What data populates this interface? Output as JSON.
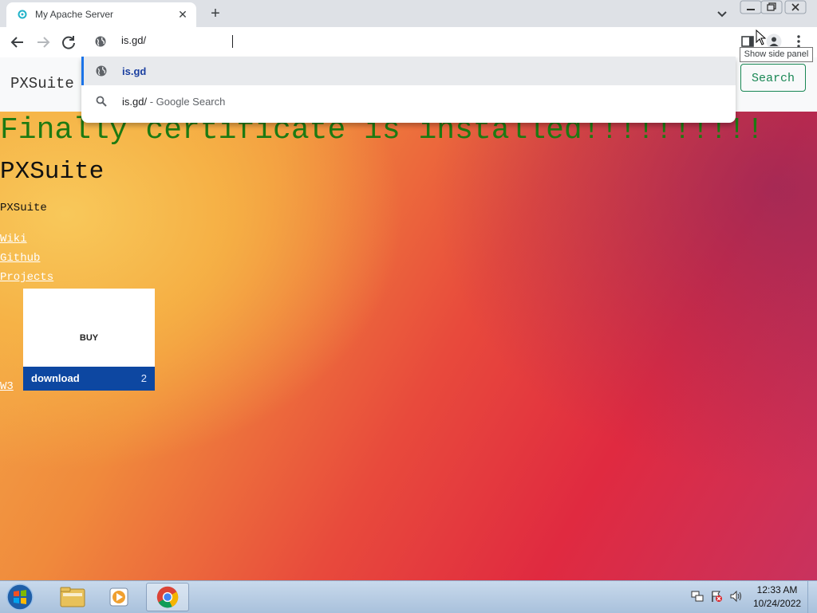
{
  "browser": {
    "tab_title": "My Apache Server",
    "new_tab_icon": "plus-icon",
    "address_value": "is.gd/",
    "tooltip": "Show side panel",
    "suggestions": [
      {
        "icon": "globe-icon",
        "text": "is.gd",
        "sub": ""
      },
      {
        "icon": "search-icon",
        "text": "is.gd/",
        "sub": " - Google Search"
      }
    ]
  },
  "page": {
    "brand": "PXSuite",
    "search_label": "Search",
    "headline": "Finally certificate is installed!!!!!!!!!!",
    "heading": "PXSuite",
    "paragraph": "PXSuite",
    "links": {
      "wiki": "Wiki",
      "github": "Github",
      "projects": "Projects",
      "w3": "W3"
    },
    "card": {
      "buy": "BUY",
      "download": "download",
      "count": "2"
    }
  },
  "taskbar": {
    "time": "12:33 AM",
    "date": "10/24/2022",
    "apps": [
      "windows-explorer",
      "media-player",
      "google-chrome"
    ]
  },
  "colors": {
    "headline": "#1d7a12",
    "search_button": "#198754",
    "card_bar": "#0d47a1",
    "highlight": "#1a73e8"
  }
}
